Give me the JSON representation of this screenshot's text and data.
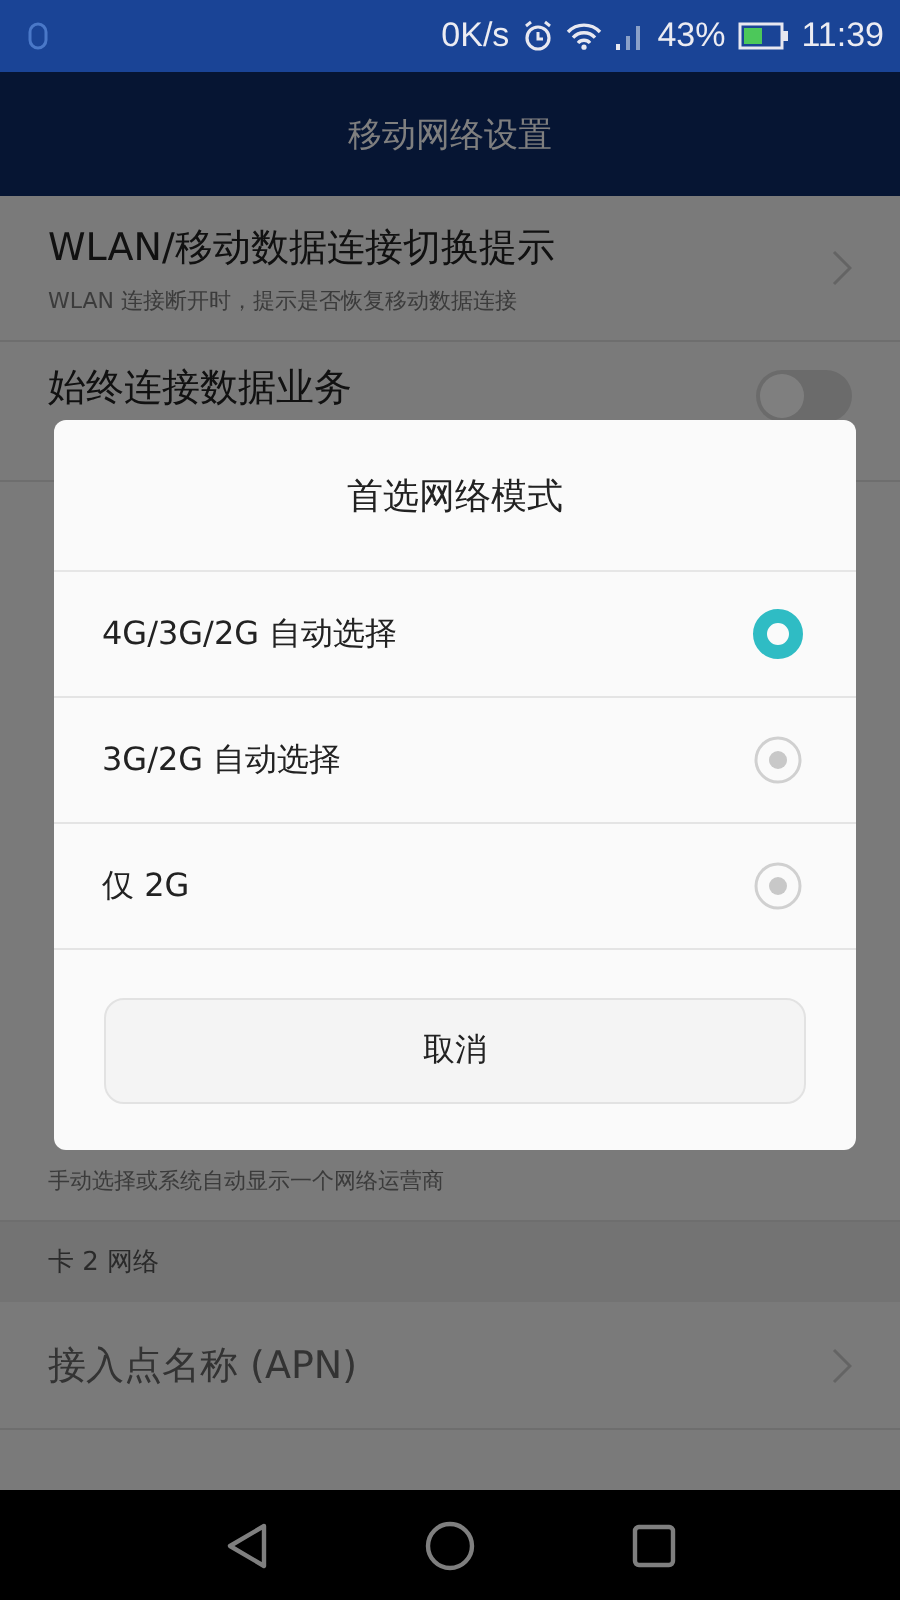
{
  "status_bar": {
    "speed": "0K/s",
    "battery": "43%",
    "time": "11:39"
  },
  "header": {
    "title": "移动网络设置"
  },
  "settings": [
    {
      "kind": "item",
      "title": "WLAN/移动数据连接切换提示",
      "subtitle": "WLAN 连接断开时，提示是否恢复移动数据连接"
    },
    {
      "kind": "toggle",
      "title": "始终连接数据业务",
      "on": false
    }
  ],
  "lower_settings": [
    {
      "kind": "subtitle",
      "subtitle": "手动选择或系统自动显示一个网络运营商"
    },
    {
      "kind": "section",
      "title": "卡 2 网络"
    },
    {
      "kind": "item",
      "title": "接入点名称 (APN)"
    }
  ],
  "dialog": {
    "title": "首选网络模式",
    "options": [
      {
        "label": "4G/3G/2G 自动选择",
        "selected": true
      },
      {
        "label": "3G/2G 自动选择",
        "selected": false
      },
      {
        "label": "仅 2G",
        "selected": false
      }
    ],
    "cancel": "取消"
  }
}
